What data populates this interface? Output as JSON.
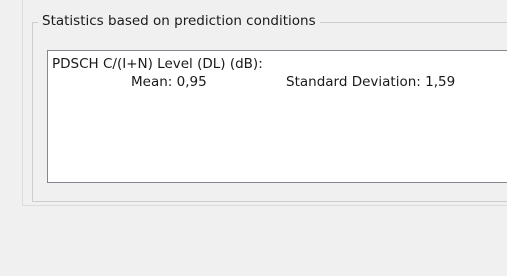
{
  "statistics_group": {
    "title": "Statistics based on prediction conditions",
    "metric_label": "PDSCH C/(I+N) Level (DL) (dB):",
    "mean": "Mean: 0,95",
    "standard_deviation": "Standard Deviation: 1,59"
  }
}
